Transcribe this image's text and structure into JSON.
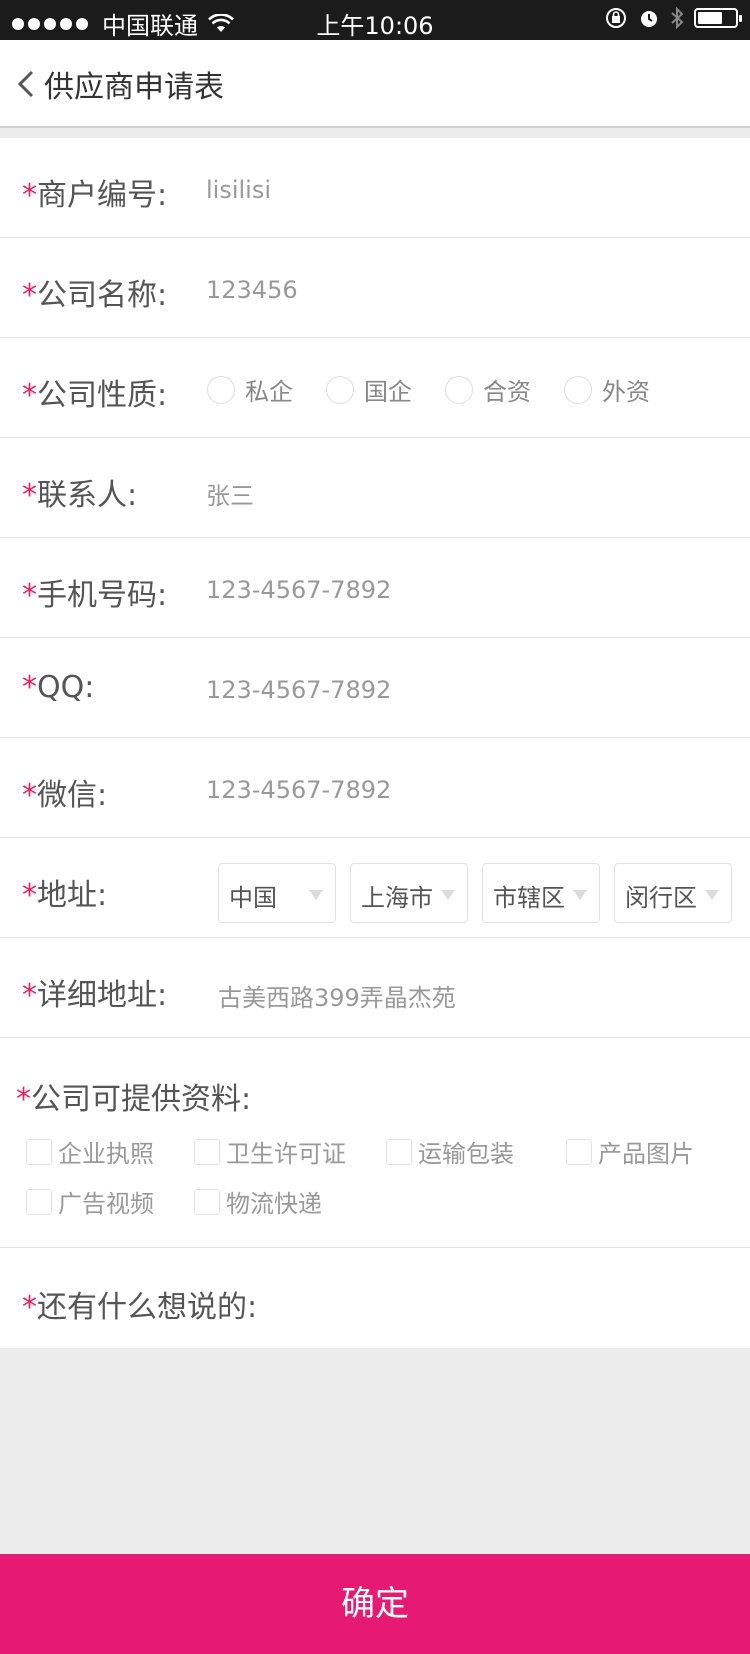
{
  "status_bar": {
    "carrier": "中国联通",
    "time": "上午10:06"
  },
  "nav": {
    "title": "供应商申请表"
  },
  "form": {
    "required_mark": "*",
    "merchant_id": {
      "label": "商户编号:",
      "value": "lisilisi"
    },
    "company_name": {
      "label": "公司名称:",
      "value": "123456"
    },
    "company_type": {
      "label": "公司性质:",
      "options": [
        "私企",
        "国企",
        "合资",
        "外资"
      ]
    },
    "contact": {
      "label": "联系人:",
      "value": "张三"
    },
    "mobile": {
      "label": "手机号码:",
      "value": "123-4567-7892"
    },
    "qq": {
      "label": "QQ:",
      "value": "123-4567-7892"
    },
    "wechat": {
      "label": "微信:",
      "value": "123-4567-7892"
    },
    "address": {
      "label": "地址:",
      "country": "中国",
      "city": "上海市",
      "district_type": "市辖区",
      "district": "闵行区"
    },
    "detail_address": {
      "label": "详细地址:",
      "value": "古美西路399弄晶杰苑"
    },
    "materials": {
      "label": "公司可提供资料:",
      "options": [
        "企业执照",
        "卫生许可证",
        "运输包装",
        "产品图片",
        "广告视频",
        "物流快递"
      ]
    },
    "comments": {
      "label": "还有什么想说的:"
    }
  },
  "submit_label": "确定"
}
